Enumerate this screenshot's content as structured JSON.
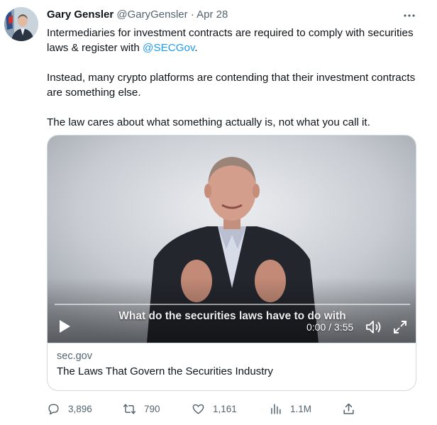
{
  "tweet": {
    "author_name": "Gary Gensler",
    "author_handle": "@GaryGensler",
    "separator": "·",
    "date": "Apr 28",
    "more_icon": "more-horizontal-icon",
    "text_line1": "Intermediaries for investment contracts are required to comply with securities laws & register with ",
    "mention": "@SECGov",
    "text_line1_end": ".",
    "text_para2": "Instead, many crypto platforms are contending that their investment contracts are something else.",
    "text_para3": "The law cares about what something actually is, not what you call it."
  },
  "card": {
    "video": {
      "caption": "What do the securities laws have to do with",
      "timecode": "0:00 / 3:55",
      "progress": 0.0,
      "play_icon": "play-icon",
      "volume_icon": "volume-icon",
      "fullscreen_icon": "fullscreen-icon"
    },
    "domain": "sec.gov",
    "title": "The Laws That Govern the Securities Industry"
  },
  "actions": {
    "replies": "3,896",
    "retweets": "790",
    "likes": "1,161",
    "views": "1.1M"
  },
  "colors": {
    "link": "#1d9bf0",
    "secondary_text": "#536471",
    "border": "#cfd9de"
  }
}
